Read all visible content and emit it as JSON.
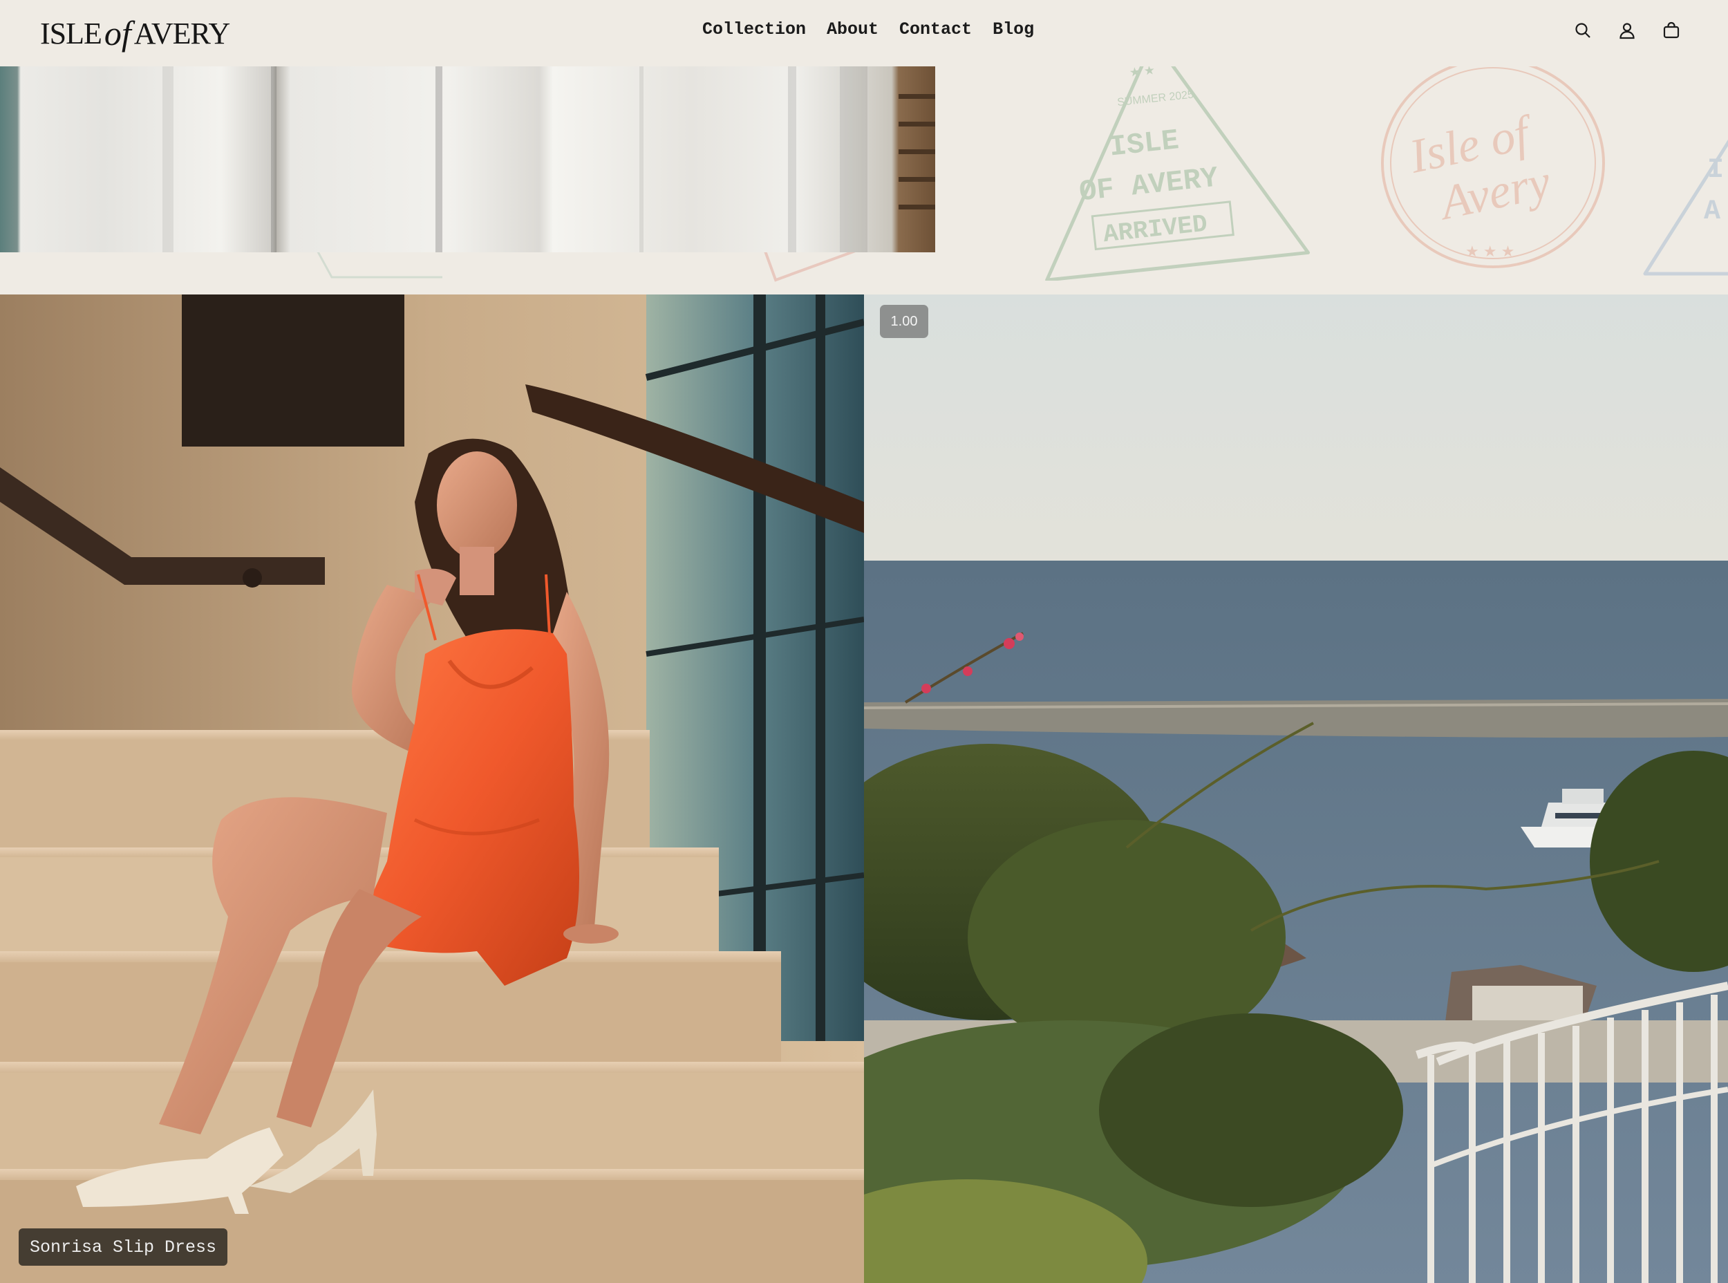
{
  "brand": {
    "logo_left": "ISLE",
    "logo_of": "of",
    "logo_right": "AVERY"
  },
  "nav": {
    "items": [
      "Collection",
      "About",
      "Contact",
      "Blog"
    ]
  },
  "header_icons": [
    "search-icon",
    "account-icon",
    "cart-bag-icon"
  ],
  "stamps": {
    "stamp1_top": "SUMMER 2025",
    "stamp1_line1": "ISLE",
    "stamp1_line2": "OF AVERY",
    "stamp1_bottom": "ARRIVED",
    "stamp2_script1": "Isle of",
    "stamp2_script2": "Avery"
  },
  "product": {
    "label": "Sonrisa Slip Dress"
  },
  "media": {
    "speed": "1.00"
  },
  "colors": {
    "background": "#efebe4",
    "text": "#161616",
    "dress": "#f0592c"
  }
}
